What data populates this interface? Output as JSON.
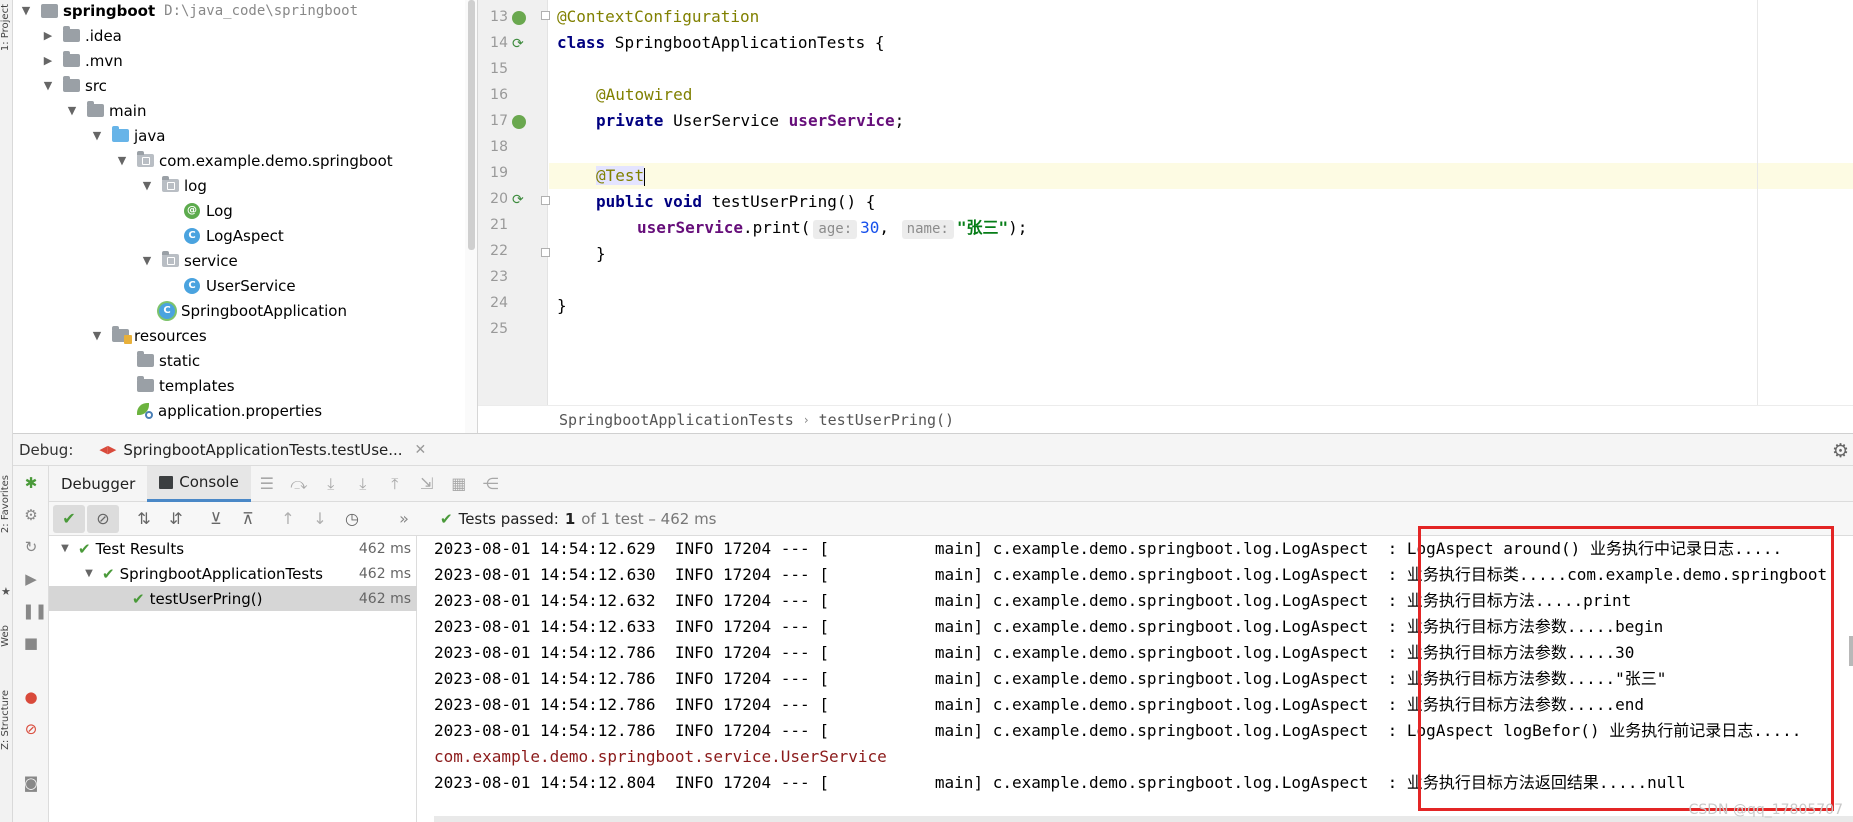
{
  "side_stripe": {
    "project_tab": "1: Project",
    "favorites_tab": "2: Favorites",
    "web_tab": "Web",
    "structure_tab": "Z: Structure"
  },
  "project_tree": {
    "root_name": "springboot",
    "root_path": "D:\\java_code\\springboot",
    "items": [
      {
        "label": "springboot"
      },
      {
        "label": ".idea"
      },
      {
        "label": ".mvn"
      },
      {
        "label": "src"
      },
      {
        "label": "main"
      },
      {
        "label": "java"
      },
      {
        "label": "com.example.demo.springboot"
      },
      {
        "label": "log"
      },
      {
        "label": "Log"
      },
      {
        "label": "LogAspect"
      },
      {
        "label": "service"
      },
      {
        "label": "UserService"
      },
      {
        "label": "SpringbootApplication"
      },
      {
        "label": "resources"
      },
      {
        "label": "static"
      },
      {
        "label": "templates"
      },
      {
        "label": "application.properties"
      }
    ]
  },
  "editor": {
    "line_numbers": [
      "13",
      "14",
      "15",
      "16",
      "17",
      "18",
      "19",
      "20",
      "21",
      "22",
      "23",
      "24",
      "25"
    ],
    "code": {
      "l13_anno": "@ContextConfiguration",
      "l14_kw": "class",
      "l14_rest": " SpringbootApplicationTests {",
      "l16_anno": "@Autowired",
      "l17_kw": "private",
      "l17_type": " UserService ",
      "l17_field": "userService",
      "l17_end": ";",
      "l19_anno": "@Test",
      "l20_kw1": "public",
      "l20_kw2": "void",
      "l20_rest": " testUserPring() {",
      "l21_field": "userService",
      "l21_call": ".print(",
      "l21_hint1": "age:",
      "l21_num": "30",
      "l21_comma": ",",
      "l21_hint2": "name:",
      "l21_str": "\"张三\"",
      "l21_end": ");",
      "l22": "}",
      "l24": "}"
    },
    "breadcrumb": [
      "SpringbootApplicationTests",
      "testUserPring()"
    ]
  },
  "debug": {
    "label": "Debug:",
    "session_tab": "SpringbootApplicationTests.testUse...",
    "tabs": {
      "debugger": "Debugger",
      "console": "Console"
    },
    "tests_status": {
      "passed_label": "Tests passed:",
      "passed_count": "1",
      "detail": "of 1 test – 462 ms"
    },
    "results": [
      {
        "label": "Test Results",
        "time": "462 ms"
      },
      {
        "label": "SpringbootApplicationTests",
        "time": "462 ms"
      },
      {
        "label": "testUserPring()",
        "time": "462 ms"
      }
    ],
    "console_lines": [
      "2023-08-01 14:54:12.629  INFO 17204 --- [           main] c.example.demo.springboot.log.LogAspect  : LogAspect around() 业务执行中记录日志.....",
      "2023-08-01 14:54:12.630  INFO 17204 --- [           main] c.example.demo.springboot.log.LogAspect  : 业务执行目标类.....com.example.demo.springboot",
      "2023-08-01 14:54:12.632  INFO 17204 --- [           main] c.example.demo.springboot.log.LogAspect  : 业务执行目标方法.....print",
      "2023-08-01 14:54:12.633  INFO 17204 --- [           main] c.example.demo.springboot.log.LogAspect  : 业务执行目标方法参数.....begin",
      "2023-08-01 14:54:12.786  INFO 17204 --- [           main] c.example.demo.springboot.log.LogAspect  : 业务执行目标方法参数.....30",
      "2023-08-01 14:54:12.786  INFO 17204 --- [           main] c.example.demo.springboot.log.LogAspect  : 业务执行目标方法参数.....\"张三\"",
      "2023-08-01 14:54:12.786  INFO 17204 --- [           main] c.example.demo.springboot.log.LogAspect  : 业务执行目标方法参数.....end",
      "2023-08-01 14:54:12.786  INFO 17204 --- [           main] c.example.demo.springboot.log.LogAspect  : LogAspect logBefor() 业务执行前记录日志.....",
      "com.example.demo.springboot.service.UserService",
      "2023-08-01 14:54:12.804  INFO 17204 --- [           main] c.example.demo.springboot.log.LogAspect  : 业务执行目标方法返回结果.....null"
    ]
  },
  "watermark": "CSDN @qq_17805707",
  "colors": {
    "accent": "#4a88c7",
    "pass_green": "#4a9a3a",
    "highlight_red": "#e32525"
  }
}
